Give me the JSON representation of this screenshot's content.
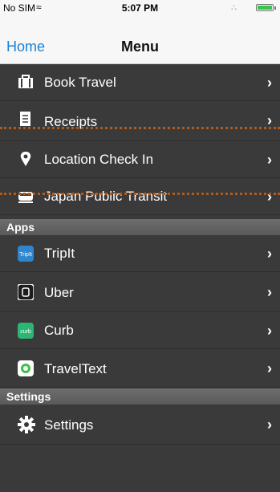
{
  "status_bar": {
    "carrier": "No SIM",
    "time": "5:07 PM"
  },
  "nav": {
    "back_label": "Home",
    "title": "Menu"
  },
  "menu_items": [
    {
      "label": "Book Travel",
      "icon": "briefcase-icon"
    },
    {
      "label": "Receipts",
      "icon": "receipt-icon"
    },
    {
      "label": "Location Check In",
      "icon": "location-pin-icon"
    },
    {
      "label": "Japan Public Transit",
      "icon": "train-icon"
    }
  ],
  "sections": {
    "apps": "Apps",
    "settings": "Settings"
  },
  "apps": [
    {
      "label": "TripIt",
      "icon": "tripit-icon",
      "color": "#2e86d1"
    },
    {
      "label": "Uber",
      "icon": "uber-icon",
      "color": "#1c1c1c"
    },
    {
      "label": "Curb",
      "icon": "curb-icon",
      "color": "#2bb673"
    },
    {
      "label": "TravelText",
      "icon": "traveltext-icon",
      "color": "#3fbf4a"
    }
  ],
  "settings_items": [
    {
      "label": "Settings",
      "icon": "gear-icon"
    }
  ],
  "colors": {
    "background": "#3a3a3a",
    "accent": "#1a82d8",
    "annotation": "#b05a1c"
  }
}
